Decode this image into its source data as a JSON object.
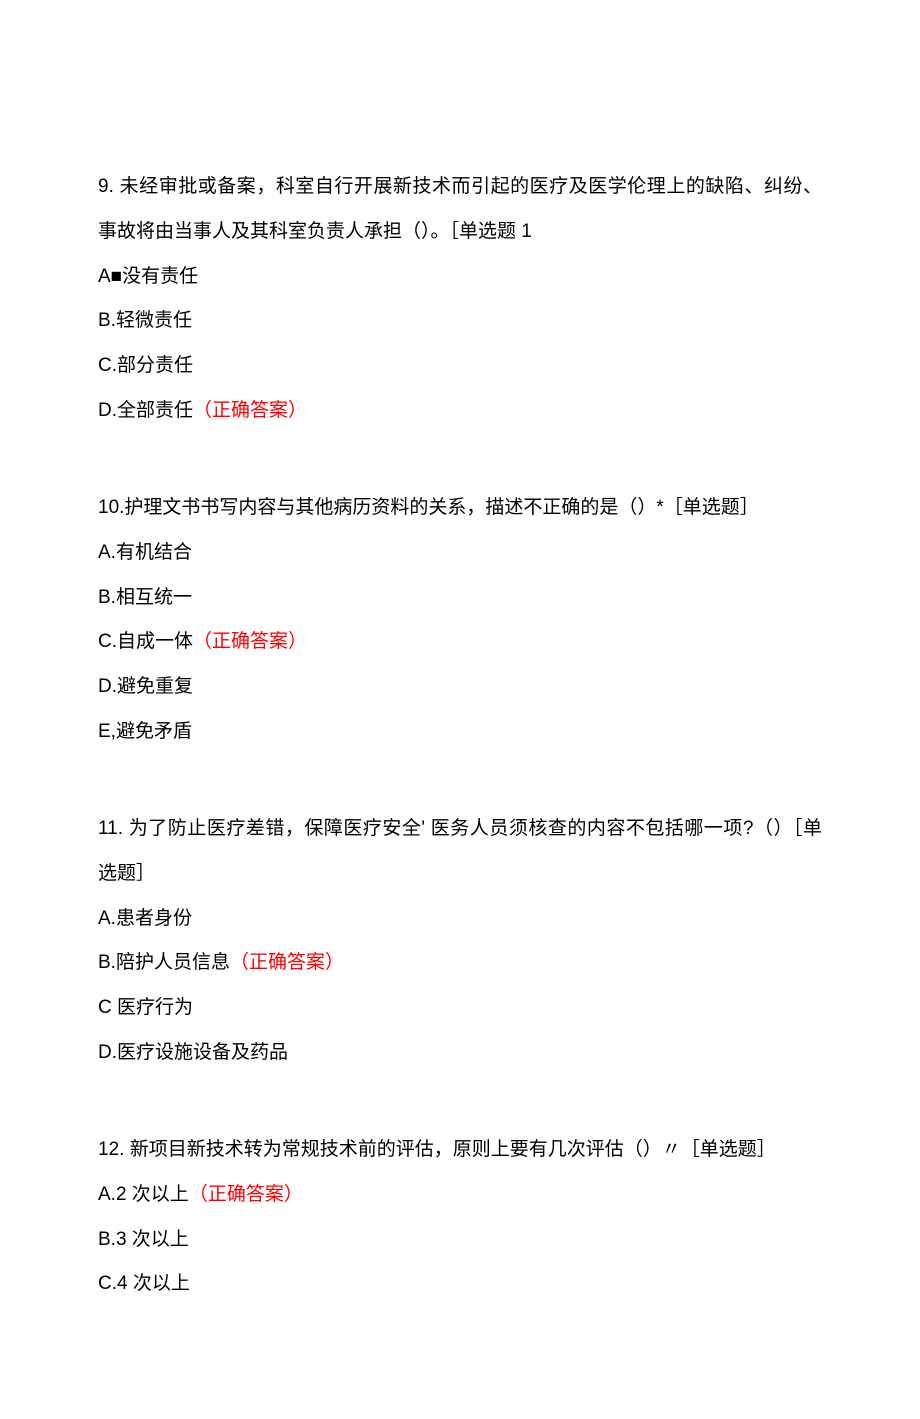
{
  "questions": [
    {
      "stem": "9. 未经审批或备案，科室自行开展新技术而引起的医疗及医学伦理上的缺陷、纠纷、事故将由当事人及其科室负责人承担（）。［单选题 1",
      "options": [
        {
          "text": "A■没有责任",
          "correct": false,
          "marker": ""
        },
        {
          "text": "B.轻微责任",
          "correct": false,
          "marker": ""
        },
        {
          "text": "C.部分责任",
          "correct": false,
          "marker": ""
        },
        {
          "text": "D.全部责任",
          "correct": true,
          "marker": "（正确答案）"
        }
      ]
    },
    {
      "stem": "10.护理文书书写内容与其他病历资料的关系，描述不正确的是（）*［单选题］",
      "options": [
        {
          "text": "A.有机结合",
          "correct": false,
          "marker": ""
        },
        {
          "text": "B.相互统一",
          "correct": false,
          "marker": ""
        },
        {
          "text": "C.自成一体",
          "correct": true,
          "marker": "（正确答案）"
        },
        {
          "text": "D.避免重复",
          "correct": false,
          "marker": ""
        },
        {
          "text": "E,避免矛盾",
          "correct": false,
          "marker": ""
        }
      ]
    },
    {
      "stem": "11. 为了防止医疗差错，保障医疗安全' 医务人员须核查的内容不包括哪一项?（）［单选题］",
      "options": [
        {
          "text": "A.患者身份",
          "correct": false,
          "marker": ""
        },
        {
          "text": "B.陪护人员信息",
          "correct": true,
          "marker": "（正确答案）"
        },
        {
          "text": "C 医疗行为",
          "correct": false,
          "marker": ""
        },
        {
          "text": "D.医疗设施设备及药品",
          "correct": false,
          "marker": ""
        }
      ]
    },
    {
      "stem": "12. 新项目新技术转为常规技术前的评估，原则上要有几次评估（）〃［单选题］",
      "options": [
        {
          "text": "A.2 次以上",
          "correct": true,
          "marker": "（正确答案）"
        },
        {
          "text": "B.3 次以上",
          "correct": false,
          "marker": ""
        },
        {
          "text": "C.4 次以上",
          "correct": false,
          "marker": ""
        }
      ]
    }
  ]
}
